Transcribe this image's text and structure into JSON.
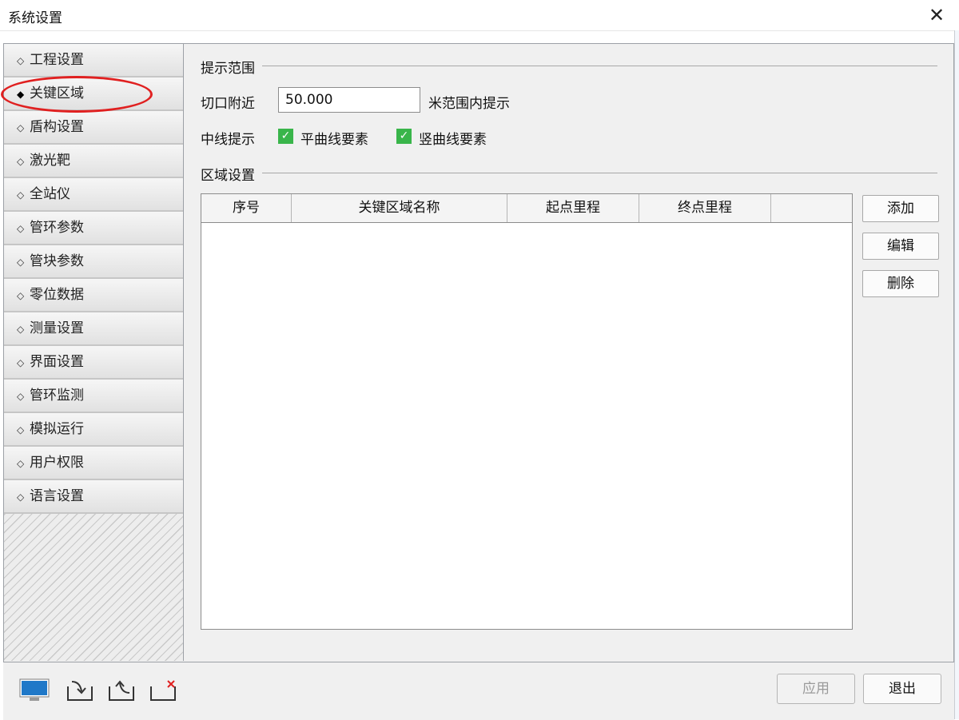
{
  "window": {
    "title": "系统设置",
    "close_icon": "close-icon"
  },
  "sidebar": {
    "items": [
      {
        "label": "工程设置",
        "bullet": "◇"
      },
      {
        "label": "关键区域",
        "bullet": "◆"
      },
      {
        "label": "盾构设置",
        "bullet": "◇"
      },
      {
        "label": "激光靶",
        "bullet": "◇"
      },
      {
        "label": "全站仪",
        "bullet": "◇"
      },
      {
        "label": "管环参数",
        "bullet": "◇"
      },
      {
        "label": "管块参数",
        "bullet": "◇"
      },
      {
        "label": "零位数据",
        "bullet": "◇"
      },
      {
        "label": "测量设置",
        "bullet": "◇"
      },
      {
        "label": "界面设置",
        "bullet": "◇"
      },
      {
        "label": "管环监测",
        "bullet": "◇"
      },
      {
        "label": "模拟运行",
        "bullet": "◇"
      },
      {
        "label": "用户权限",
        "bullet": "◇"
      },
      {
        "label": "语言设置",
        "bullet": "◇"
      }
    ]
  },
  "prompt": {
    "section_title": "提示范围",
    "cut_label": "切口附近",
    "cut_value": "50.000",
    "cut_suffix": "米范围内提示",
    "centerline_label": "中线提示",
    "check1_label": "平曲线要素",
    "check2_label": "竖曲线要素",
    "check_mark": "✓"
  },
  "region": {
    "section_title": "区域设置",
    "columns": [
      "序号",
      "关键区域名称",
      "起点里程",
      "终点里程"
    ],
    "buttons": {
      "add": "添加",
      "edit": "编辑",
      "delete": "删除"
    }
  },
  "footer": {
    "apply": "应用",
    "exit": "退出"
  },
  "colors": {
    "accent_check": "#39b54a",
    "annotation": "#e02020",
    "monitor_icon": "#1f78c8"
  }
}
